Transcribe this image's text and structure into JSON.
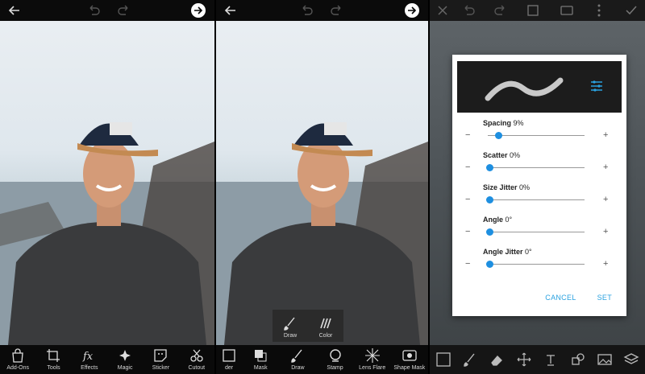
{
  "panel1": {
    "tools": [
      {
        "label": "Add-Ons",
        "icon": "shopping-bag-icon"
      },
      {
        "label": "Tools",
        "icon": "crop-icon"
      },
      {
        "label": "Effects",
        "icon": "fx-icon"
      },
      {
        "label": "Magic",
        "icon": "sparkle-icon"
      },
      {
        "label": "Sticker",
        "icon": "sticker-icon"
      },
      {
        "label": "Cutout",
        "icon": "scissors-icon"
      }
    ]
  },
  "panel2": {
    "popup": [
      {
        "label": "Draw",
        "icon": "brush-icon"
      },
      {
        "label": "Color",
        "icon": "color-icon"
      }
    ],
    "tools": [
      {
        "label": "der",
        "icon": "border-icon"
      },
      {
        "label": "Mask",
        "icon": "mask-icon"
      },
      {
        "label": "Draw",
        "icon": "brush-icon"
      },
      {
        "label": "Stamp",
        "icon": "stamp-icon"
      },
      {
        "label": "Lens Flare",
        "icon": "lens-flare-icon"
      },
      {
        "label": "Shape Mask",
        "icon": "shape-mask-icon"
      }
    ]
  },
  "brush_settings": {
    "sliders": [
      {
        "label": "Spacing",
        "value": "9%",
        "level": 0.09
      },
      {
        "label": "Scatter",
        "value": "0%",
        "level": 0.0
      },
      {
        "label": "Size Jitter",
        "value": "0%",
        "level": 0.0
      },
      {
        "label": "Angle",
        "value": "0°",
        "level": 0.0
      },
      {
        "label": "Angle Jitter",
        "value": "0°",
        "level": 0.0
      }
    ],
    "minus": "−",
    "plus": "+",
    "cancel": "CANCEL",
    "set": "SET"
  },
  "colors": {
    "accent": "#1e8fe0",
    "toolbar_bg": "#0a0a0a"
  }
}
